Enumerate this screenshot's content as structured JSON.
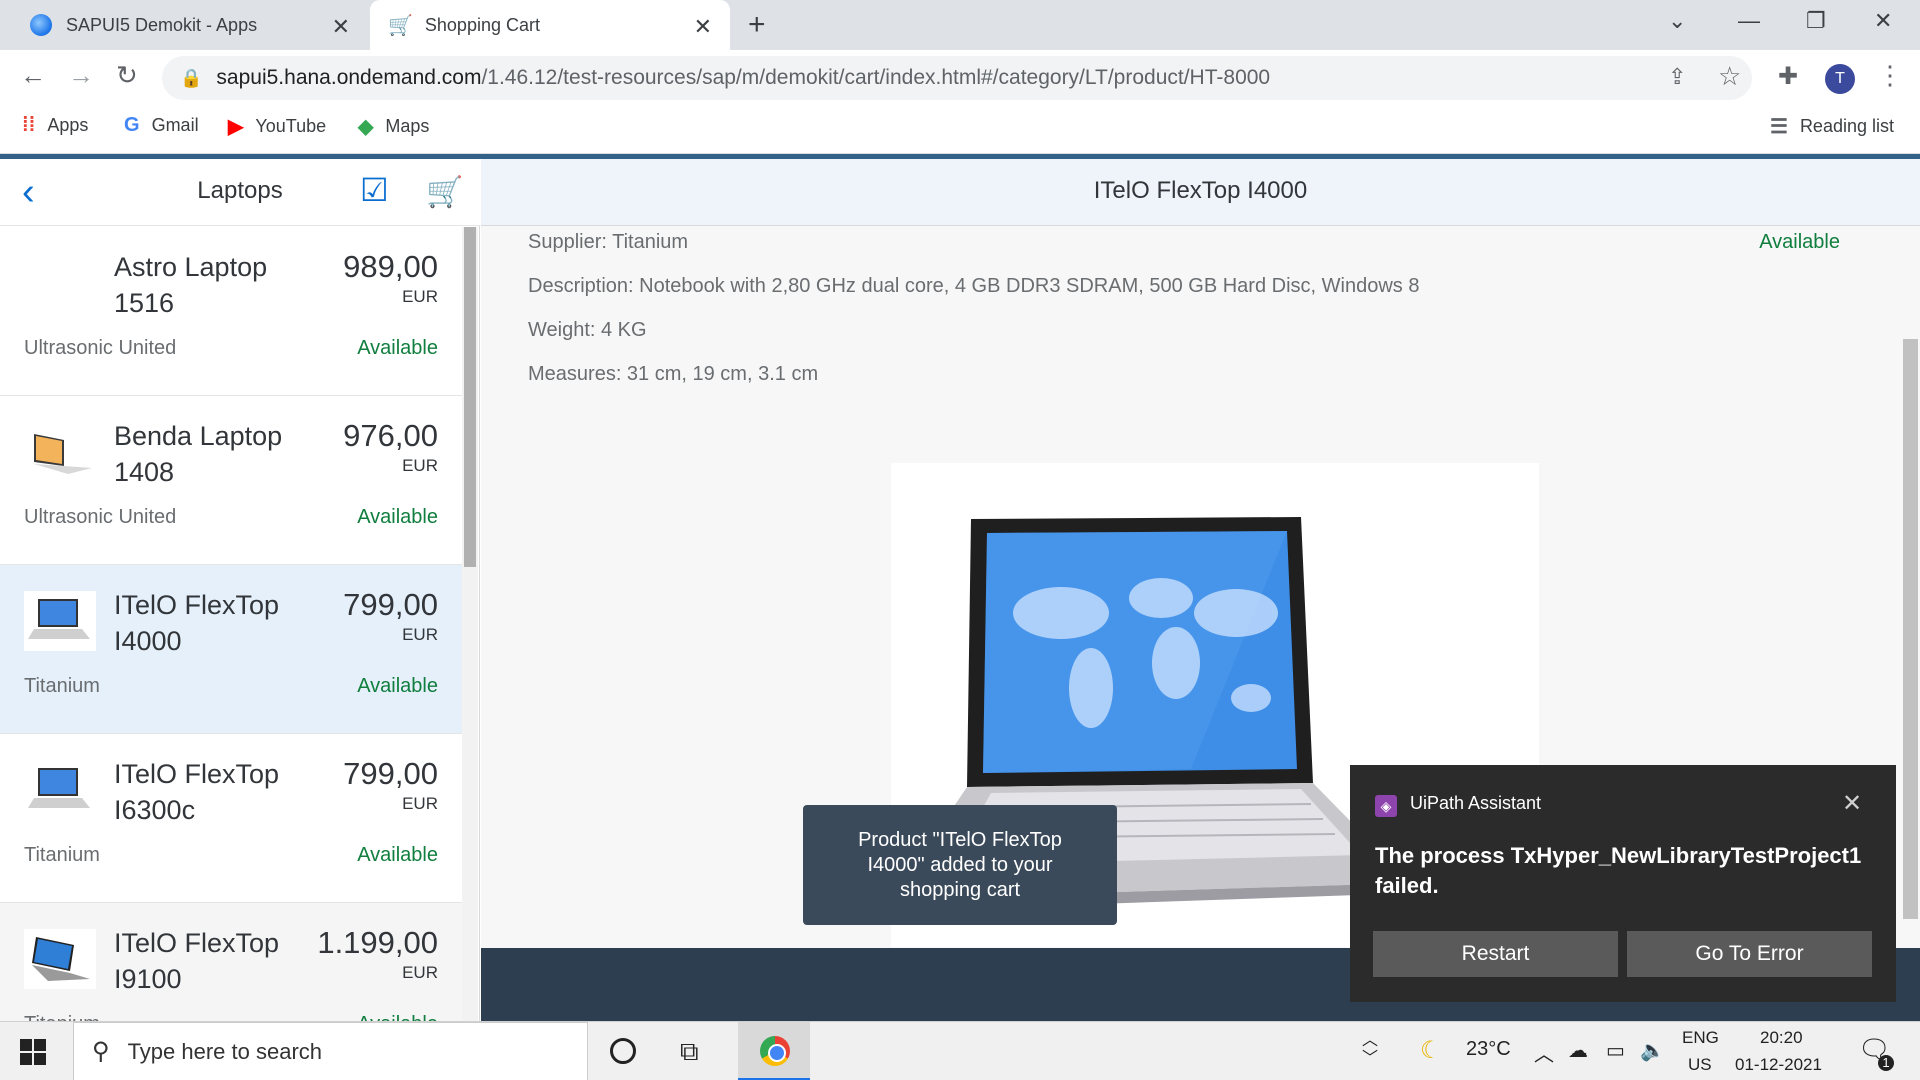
{
  "browser": {
    "tabs": [
      {
        "title": "SAPUI5 Demokit - Apps",
        "active": false
      },
      {
        "title": "Shopping Cart",
        "active": true
      }
    ],
    "url_host": "sapui5.hana.ondemand.com",
    "url_path": "/1.46.12/test-resources/sap/m/demokit/cart/index.html#/category/LT/product/HT-8000",
    "avatar_letter": "T",
    "bookmarks": [
      "Apps",
      "Gmail",
      "YouTube",
      "Maps"
    ],
    "reading_list": "Reading list"
  },
  "master": {
    "title": "Laptops",
    "items": [
      {
        "name": "Astro Laptop 1516",
        "price": "989,00",
        "currency": "EUR",
        "supplier": "Ultrasonic United",
        "status": "Available",
        "selected": false
      },
      {
        "name": "Benda Laptop 1408",
        "price": "976,00",
        "currency": "EUR",
        "supplier": "Ultrasonic United",
        "status": "Available",
        "selected": false
      },
      {
        "name": "ITelO FlexTop I4000",
        "price": "799,00",
        "currency": "EUR",
        "supplier": "Titanium",
        "status": "Available",
        "selected": true
      },
      {
        "name": "ITelO FlexTop I6300c",
        "price": "799,00",
        "currency": "EUR",
        "supplier": "Titanium",
        "status": "Available",
        "selected": false
      },
      {
        "name": "ITelO FlexTop I9100",
        "price": "1.199,00",
        "currency": "EUR",
        "supplier": "Titanium",
        "status": "Available",
        "selected": false
      }
    ]
  },
  "detail": {
    "title": "ITelO FlexTop I4000",
    "supplier": "Supplier: Titanium",
    "status": "Available",
    "description": "Description: Notebook with 2,80 GHz dual core, 4 GB DDR3 SDRAM, 500 GB Hard Disc, Windows 8",
    "weight": "Weight: 4 KG",
    "measures": "Measures: 31 cm, 19 cm, 3.1 cm"
  },
  "toast": "Product \"ITelO FlexTop I4000\" added to your shopping cart",
  "uipath": {
    "app": "UiPath Assistant",
    "message": "The process TxHyper_NewLibraryTestProject1 failed.",
    "restart": "Restart",
    "go_to_error": "Go To Error"
  },
  "taskbar": {
    "search_placeholder": "Type here to search",
    "temperature": "23°C",
    "lang1": "ENG",
    "lang2": "US",
    "time": "20:20",
    "date": "01-12-2021",
    "notifications": "1"
  },
  "colors": {
    "accent": "#0a6ed1",
    "positive": "#107e3e",
    "shell": "#346187"
  }
}
